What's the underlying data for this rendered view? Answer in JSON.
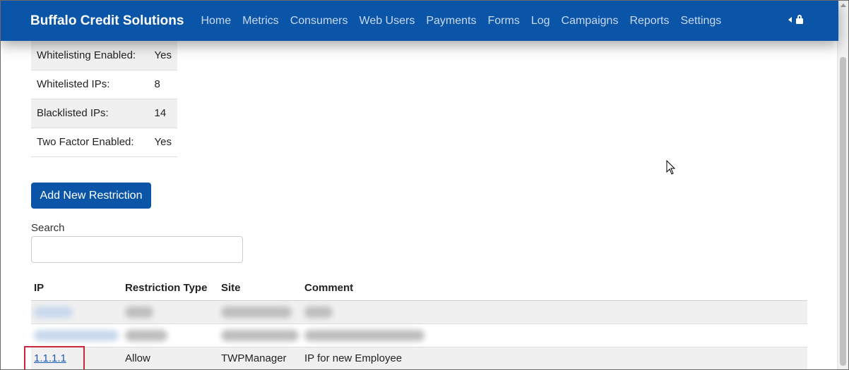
{
  "navbar": {
    "brand": "Buffalo Credit Solutions",
    "links": [
      "Home",
      "Metrics",
      "Consumers",
      "Web Users",
      "Payments",
      "Forms",
      "Log",
      "Campaigns",
      "Reports",
      "Settings"
    ],
    "bg_color": "#0a55a8"
  },
  "stats": [
    {
      "label": "Whitelisting Enabled:",
      "value": "Yes"
    },
    {
      "label": "Whitelisted IPs:",
      "value": "8"
    },
    {
      "label": "Blacklisted IPs:",
      "value": "14"
    },
    {
      "label": "Two Factor Enabled:",
      "value": "Yes"
    }
  ],
  "add_button_label": "Add New Restriction",
  "search": {
    "label": "Search",
    "value": "",
    "placeholder": ""
  },
  "table": {
    "headers": [
      "IP",
      "Restriction Type",
      "Site",
      "Comment"
    ],
    "visible_row": {
      "ip": "1.1.1.1",
      "type": "Allow",
      "site": "TWPManager",
      "comment": "IP for new Employee"
    }
  },
  "colors": {
    "highlight_border": "#c8283a",
    "link": "#1a5bb3"
  }
}
